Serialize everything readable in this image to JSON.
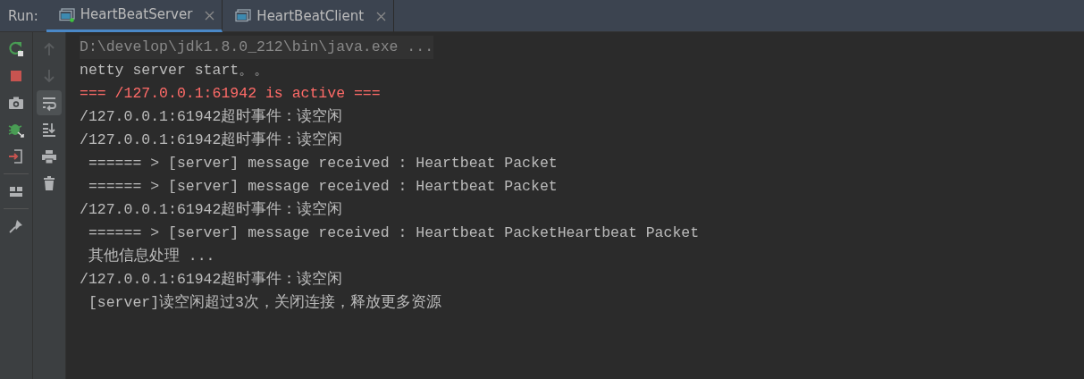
{
  "run_label": "Run:",
  "tabs": [
    {
      "label": "HeartBeatServer",
      "selected": true,
      "running": true
    },
    {
      "label": "HeartBeatClient",
      "selected": false,
      "running": false
    }
  ],
  "side_toolbar": [
    {
      "kind": "rerun"
    },
    {
      "kind": "stop"
    },
    {
      "kind": "camera"
    },
    {
      "kind": "debug"
    },
    {
      "kind": "exit"
    },
    {
      "kind": "sep"
    },
    {
      "kind": "layout"
    },
    {
      "kind": "sep"
    },
    {
      "kind": "pin"
    }
  ],
  "console_toolbar": [
    {
      "kind": "up",
      "disabled": true,
      "selected": false
    },
    {
      "kind": "down",
      "disabled": true,
      "selected": false
    },
    {
      "kind": "wrap",
      "disabled": false,
      "selected": true
    },
    {
      "kind": "scroll-end",
      "disabled": false,
      "selected": false
    },
    {
      "kind": "print",
      "disabled": false,
      "selected": false
    },
    {
      "kind": "trash",
      "disabled": false,
      "selected": false
    }
  ],
  "console_lines": [
    {
      "kind": "command",
      "text": "D:\\develop\\jdk1.8.0_212\\bin\\java.exe ..."
    },
    {
      "kind": "output",
      "text": "netty server start。。"
    },
    {
      "kind": "error",
      "text": "=== /127.0.0.1:61942 is active ==="
    },
    {
      "kind": "output",
      "text": "/127.0.0.1:61942超时事件：读空闲"
    },
    {
      "kind": "output",
      "text": "/127.0.0.1:61942超时事件：读空闲"
    },
    {
      "kind": "output",
      "text": " ====== > [server] message received : Heartbeat Packet"
    },
    {
      "kind": "output",
      "text": " ====== > [server] message received : Heartbeat Packet"
    },
    {
      "kind": "output",
      "text": "/127.0.0.1:61942超时事件：读空闲"
    },
    {
      "kind": "output",
      "text": " ====== > [server] message received : Heartbeat PacketHeartbeat Packet"
    },
    {
      "kind": "output",
      "text": " 其他信息处理 ..."
    },
    {
      "kind": "output",
      "text": "/127.0.0.1:61942超时事件：读空闲"
    },
    {
      "kind": "output",
      "text": " [server]读空闲超过3次，关闭连接，释放更多资源"
    }
  ]
}
